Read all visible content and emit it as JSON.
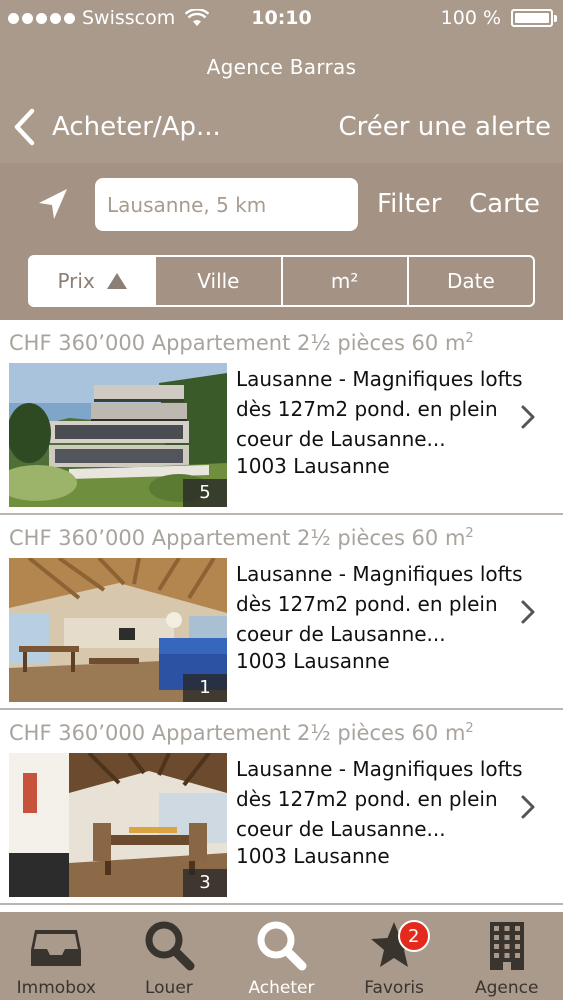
{
  "status": {
    "carrier": "Swisscom",
    "time": "10:10",
    "battery": "100 %",
    "battery_level": 1.0
  },
  "header": {
    "agency": "Agence Barras",
    "back_label": "Acheter/Ap...",
    "alert_label": "Créer une alerte"
  },
  "search": {
    "placeholder": "Lausanne, 5 km",
    "filter_label": "Filter",
    "map_label": "Carte"
  },
  "sort": {
    "options": [
      "Prix",
      "Ville",
      "m²",
      "Date"
    ],
    "active": "Prix"
  },
  "listings": [
    {
      "price_line": "CHF 360’000 Appartement 2½ pièces 60 m",
      "unit_sup": "2",
      "title": "Lausanne - Magnifiques lofts dès 127m2 pond. en plein coeur de Lausanne...",
      "zip_city": "1003 Lausanne",
      "photo_count": "5"
    },
    {
      "price_line": "CHF 360’000 Appartement 2½ pièces 60 m",
      "unit_sup": "2",
      "title": "Lausanne - Magnifiques lofts dès 127m2 pond. en plein coeur de Lausanne...",
      "zip_city": "1003 Lausanne",
      "photo_count": "1"
    },
    {
      "price_line": "CHF 360’000 Appartement 2½ pièces 60 m",
      "unit_sup": "2",
      "title": "Lausanne - Magnifiques lofts dès 127m2 pond. en plein coeur de Lausanne...",
      "zip_city": "1003 Lausanne",
      "photo_count": "3"
    }
  ],
  "tabs": [
    {
      "label": "Immobox",
      "icon": "inbox-icon"
    },
    {
      "label": "Louer",
      "icon": "search-icon"
    },
    {
      "label": "Acheter",
      "icon": "search-icon"
    },
    {
      "label": "Favoris",
      "icon": "star-icon",
      "badge": "2"
    },
    {
      "label": "Agence",
      "icon": "building-icon"
    }
  ],
  "colors": {
    "header_bg": "#aa9a8c",
    "search_band_bg": "#a49384",
    "badge_red": "#e42a1d"
  }
}
